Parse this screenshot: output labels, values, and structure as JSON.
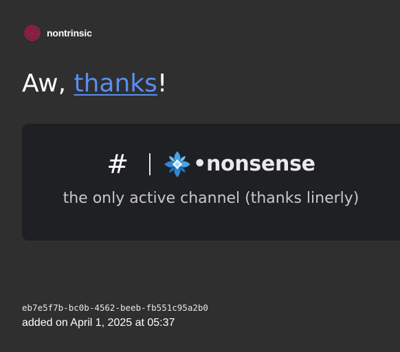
{
  "brand": {
    "name": "nontrinsic",
    "logo_icon": "dotted-sphere-icon",
    "logo_color": "#e0245e"
  },
  "headline": {
    "prefix": "Aw, ",
    "link_text": "thanks",
    "suffix": "!",
    "link_color": "#5b8ef2"
  },
  "channel_card": {
    "hash_symbol": "#",
    "separator_icon": "vertical-bar",
    "emoji_icon": "blue-flower-icon",
    "channel_name": "•nonsense",
    "description": "the only active channel (thanks linerly)",
    "background": "#1f2024"
  },
  "footer": {
    "id": "eb7e5f7b-bc0b-4562-beeb-fb551c95a2b0",
    "added_text": "added on April 1, 2025 at 05:37"
  }
}
